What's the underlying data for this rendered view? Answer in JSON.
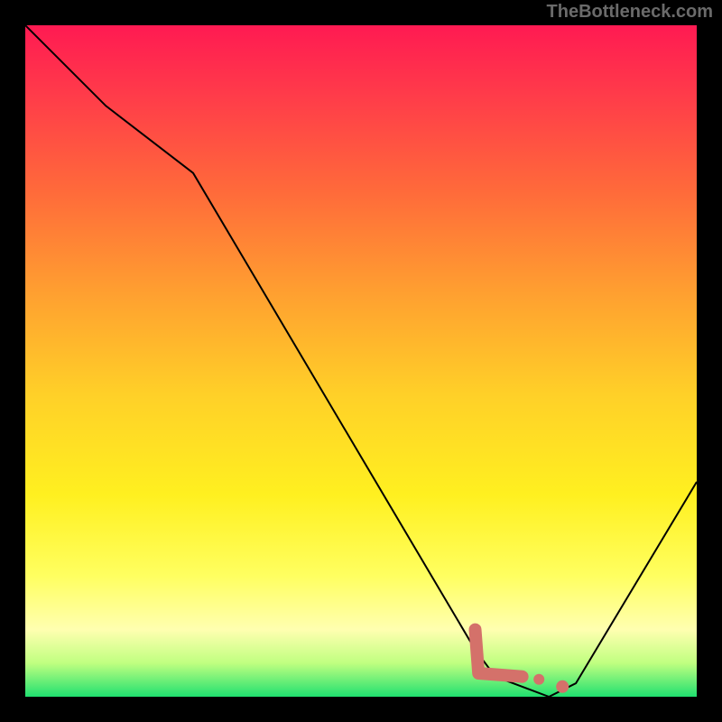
{
  "watermark": "TheBottleneck.com",
  "chart_data": {
    "type": "line",
    "title": "",
    "xlabel": "",
    "ylabel": "",
    "xlim": [
      0,
      100
    ],
    "ylim": [
      0,
      100
    ],
    "grid": false,
    "legend": false,
    "background_gradient": {
      "stops": [
        {
          "pos": 0,
          "color": "#ff1a52"
        },
        {
          "pos": 25,
          "color": "#ff6b3a"
        },
        {
          "pos": 55,
          "color": "#ffd028"
        },
        {
          "pos": 82,
          "color": "#ffff60"
        },
        {
          "pos": 95,
          "color": "#c0ff80"
        },
        {
          "pos": 100,
          "color": "#20e070"
        }
      ]
    },
    "series": [
      {
        "name": "bottleneck-curve",
        "x": [
          0,
          12,
          25,
          67,
          70,
          78,
          82,
          100
        ],
        "y": [
          100,
          88,
          78,
          7,
          3,
          0,
          2,
          32
        ]
      }
    ],
    "markers": {
      "name": "highlight-region",
      "color": "#d4716a",
      "segment": {
        "x": [
          67,
          67.5,
          74
        ],
        "y": [
          10,
          3.5,
          3
        ]
      },
      "dots": [
        {
          "x": 76.5,
          "y": 2.6
        },
        {
          "x": 80,
          "y": 1.5
        }
      ]
    }
  }
}
